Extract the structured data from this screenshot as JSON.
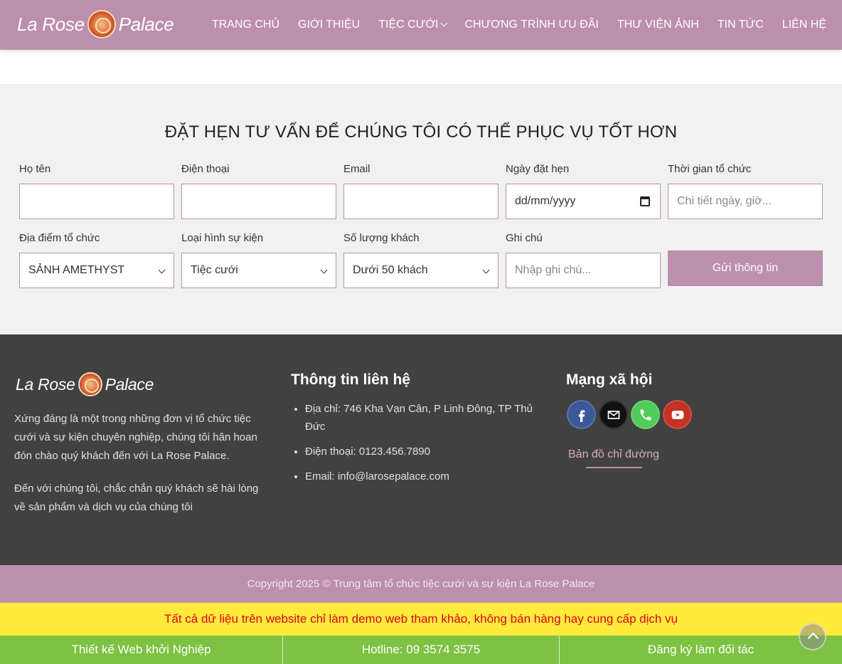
{
  "header": {
    "logo": {
      "left_text": "La Rose",
      "right_text": "Palace"
    },
    "nav": [
      {
        "label": "TRANG CHỦ"
      },
      {
        "label": "GIỚI THIỆU"
      },
      {
        "label": "TIỆC CƯỚI",
        "has_dropdown": true
      },
      {
        "label": "CHƯƠNG TRÌNH ƯU ĐÃI"
      },
      {
        "label": "THƯ VIỆN ẢNH"
      },
      {
        "label": "TIN TỨC"
      },
      {
        "label": "LIÊN HỆ"
      }
    ]
  },
  "booking": {
    "title": "ĐẶT HẸN TƯ VẤN ĐỂ CHÚNG TÔI CÓ THỂ PHỤC VỤ TỐT HƠN",
    "fields": {
      "name": {
        "label": "Họ tên",
        "value": ""
      },
      "phone": {
        "label": "Điện thoại",
        "value": ""
      },
      "email": {
        "label": "Email",
        "value": ""
      },
      "date": {
        "label": "Ngày đặt hẹn",
        "value": "dd/mm/yyyy"
      },
      "time": {
        "label": "Thời gian tổ chức",
        "placeholder": "Chi tiết ngày, giờ..."
      },
      "venue": {
        "label": "Địa điểm tổ chức",
        "selected": "SẢNH AMETHYST"
      },
      "event_type": {
        "label": "Loại hình sự kiện",
        "selected": "Tiệc cưới"
      },
      "guests": {
        "label": "Số lượng khách",
        "selected": "Dưới 50 khách"
      },
      "note": {
        "label": "Ghi chú",
        "placeholder": "Nhập ghi chú..."
      }
    },
    "submit_label": "Gửi thông tin"
  },
  "footer": {
    "logo": {
      "left_text": "La Rose",
      "right_text": "Palace"
    },
    "about": [
      "Xứng đáng là một trong những đơn vị tổ chức tiệc cưới và sự kiện chuyên nghiệp, chúng tôi hân hoan đón chào quý khách đến với La Rose Palace.",
      "Đến với chúng tôi, chắc chắn quý khách sẽ hài lòng về sản phẩm và dịch vụ của chúng tôi"
    ],
    "contact": {
      "heading": "Thông tin liên hệ",
      "address": "Địa chỉ: 746 Kha Vạn Cân, P Linh Đông, TP Thủ Đức",
      "phone": "Điện thoại: 0123.456.7890",
      "email": "Email: info@larosepalace.com"
    },
    "social": {
      "heading": "Mạng xã hội",
      "icons": [
        "facebook-icon",
        "email-icon",
        "phone-icon",
        "youtube-icon"
      ],
      "map_link": "Bản đồ chỉ đường"
    }
  },
  "copyright": "Copyright 2025 © Trung tâm tổ chức tiệc cưới và sự kiện La Rose Palace",
  "notice": "Tất cả dữ liệu trên website chỉ làm demo web tham khảo, không bán hàng hay cung cấp dịch vụ",
  "bottom_bar": [
    {
      "label": "Thiết kế Web khởi Nghiệp"
    },
    {
      "label": "Hotline: 09 3574 3575"
    },
    {
      "label": "Đăng ký làm đối tác"
    }
  ],
  "colors": {
    "brand": "#bc8fad",
    "footer_bg": "#414141",
    "notice_bg": "#ffeb3b",
    "notice_text": "#e0001b",
    "bottom_bar": "#7dc242",
    "facebook": "#3b5998",
    "email": "#111111",
    "phone": "#51cb5a",
    "youtube": "#c33223"
  }
}
